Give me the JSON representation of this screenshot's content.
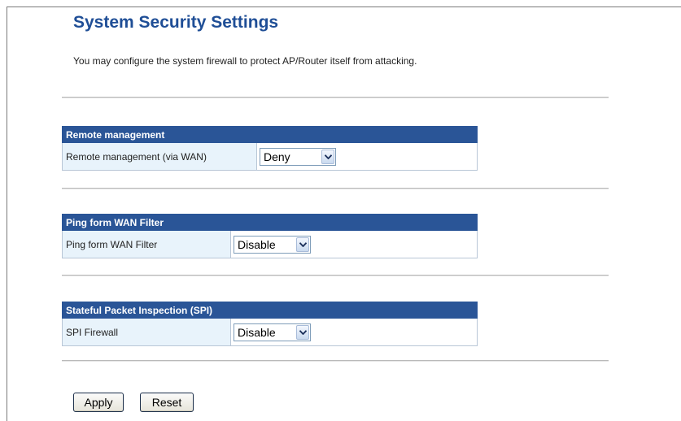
{
  "page": {
    "title": "System Security Settings",
    "description": "You may configure the system firewall to protect AP/Router itself from attacking."
  },
  "sections": [
    {
      "header": "Remote management",
      "row_label": "Remote management (via WAN)",
      "selected": "Deny"
    },
    {
      "header": "Ping form WAN Filter",
      "row_label": "Ping form WAN Filter",
      "selected": "Disable"
    },
    {
      "header": "Stateful Packet Inspection (SPI)",
      "row_label": "SPI Firewall",
      "selected": "Disable"
    }
  ],
  "buttons": {
    "apply": "Apply",
    "reset": "Reset"
  },
  "colors": {
    "title": "#1f4e96",
    "section_header_bg": "#2a5597",
    "label_cell_bg": "#e8f3fb"
  },
  "icons": {
    "dropdown": "chevron-down-icon"
  }
}
